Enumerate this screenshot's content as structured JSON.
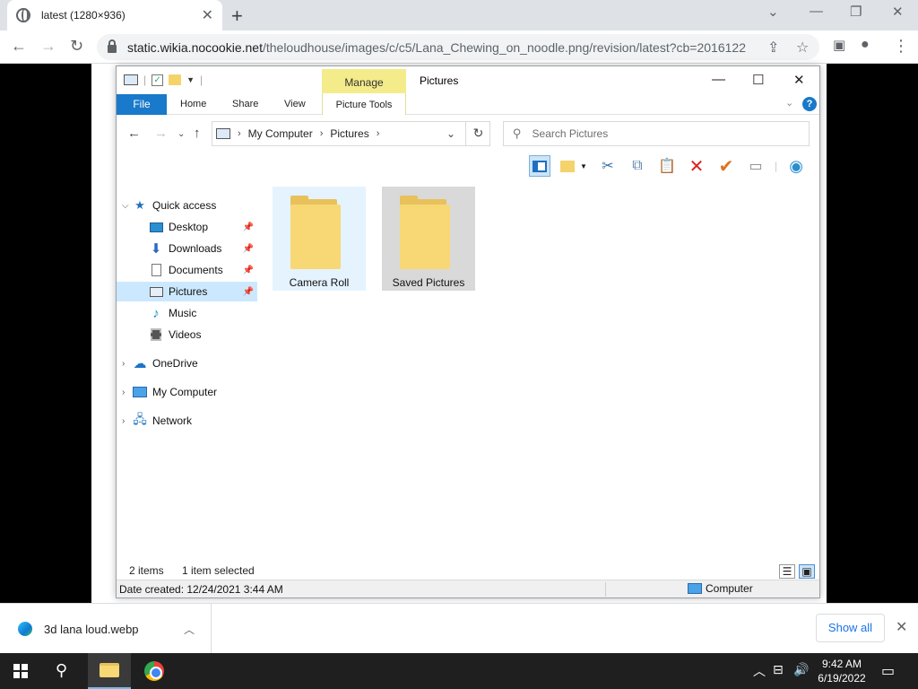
{
  "browser": {
    "tab_title": "latest (1280×936)",
    "url_host": "static.wikia.nocookie.net",
    "url_path": "/theloudhouse/images/c/c5/Lana_Chewing_on_noodle.png/revision/latest?cb=2016122..."
  },
  "explorer": {
    "window_title": "Pictures",
    "contextual_tab": "Manage",
    "contextual_group": "Picture Tools",
    "ribbon_tabs": [
      "File",
      "Home",
      "Share",
      "View"
    ],
    "breadcrumb": [
      "My Computer",
      "Pictures"
    ],
    "search_placeholder": "Search Pictures",
    "nav_tree": [
      {
        "label": "Quick access",
        "icon": "star-icon",
        "expanded": true
      },
      {
        "label": "Desktop",
        "icon": "desktop-icon",
        "pinned": true
      },
      {
        "label": "Downloads",
        "icon": "download-icon",
        "pinned": true
      },
      {
        "label": "Documents",
        "icon": "document-icon",
        "pinned": true
      },
      {
        "label": "Pictures",
        "icon": "pictures-icon",
        "pinned": true,
        "selected": true
      },
      {
        "label": "Music",
        "icon": "music-icon"
      },
      {
        "label": "Videos",
        "icon": "video-icon"
      },
      {
        "label": "OneDrive",
        "icon": "cloud-icon"
      },
      {
        "label": "My Computer",
        "icon": "computer-icon"
      },
      {
        "label": "Network",
        "icon": "network-icon"
      }
    ],
    "items": [
      {
        "label": "Camera Roll",
        "state": "hover"
      },
      {
        "label": "Saved Pictures",
        "state": "selected"
      }
    ],
    "status_count": "2 items",
    "status_selected": "1 item selected",
    "details_date": "Date created: 12/24/2021 3:44 AM",
    "details_location": "Computer"
  },
  "downloads": {
    "file_name": "3d lana loud.webp",
    "show_all": "Show all"
  },
  "taskbar": {
    "time": "9:42 AM",
    "date": "6/19/2022"
  },
  "colors": {
    "file_tab": "#1979ca",
    "manage_tab": "#f4ec8a",
    "selection": "#cce8ff",
    "taskbar": "#1f1f1f"
  }
}
